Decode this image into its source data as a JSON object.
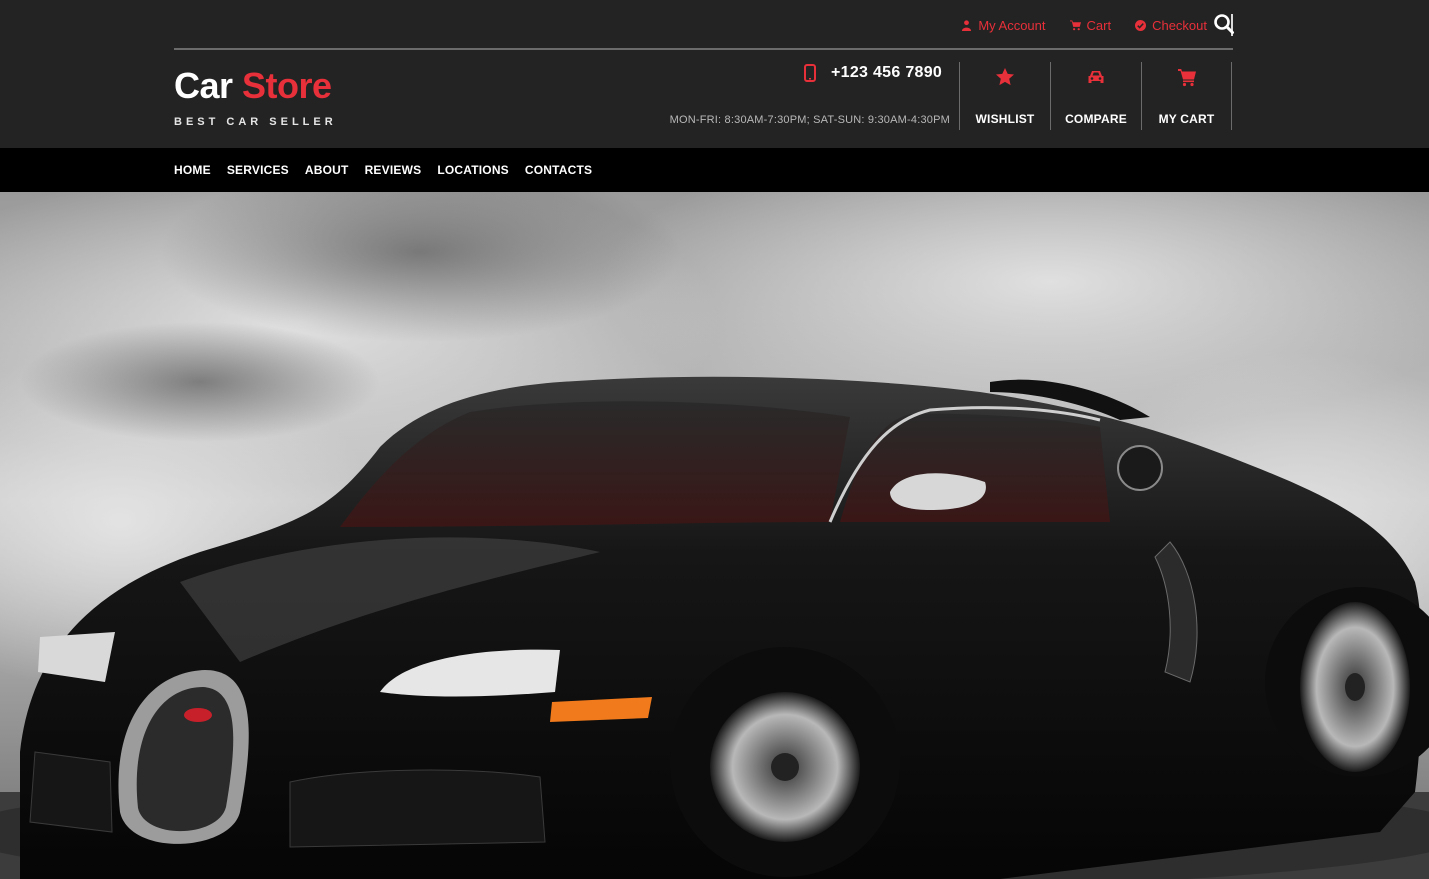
{
  "top_links": [
    {
      "label": "My Account",
      "icon": "user-icon"
    },
    {
      "label": "Cart",
      "icon": "cart-icon"
    },
    {
      "label": "Checkout",
      "icon": "check-circle-icon"
    }
  ],
  "brand": {
    "name_white": "Car",
    "name_red": "Store",
    "tagline": "BEST CAR SELLER"
  },
  "contact": {
    "phone": "+123 456 7890",
    "hours": "MON-FRI: 8:30AM-7:30PM; SAT-SUN: 9:30AM-4:30PM"
  },
  "header_actions": [
    {
      "label": "WISHLIST",
      "icon": "star-icon"
    },
    {
      "label": "COMPARE",
      "icon": "car-icon"
    },
    {
      "label": "MY CART",
      "icon": "shopping-cart-icon"
    }
  ],
  "nav": [
    "HOME",
    "SERVICES",
    "ABOUT",
    "REVIEWS",
    "LOCATIONS",
    "CONTACTS"
  ],
  "hero": {
    "image": "black sports car in smoke"
  },
  "colors": {
    "accent": "#e8303a",
    "header_bg": "#232323",
    "nav_bg": "#000000",
    "text": "#ffffff"
  }
}
